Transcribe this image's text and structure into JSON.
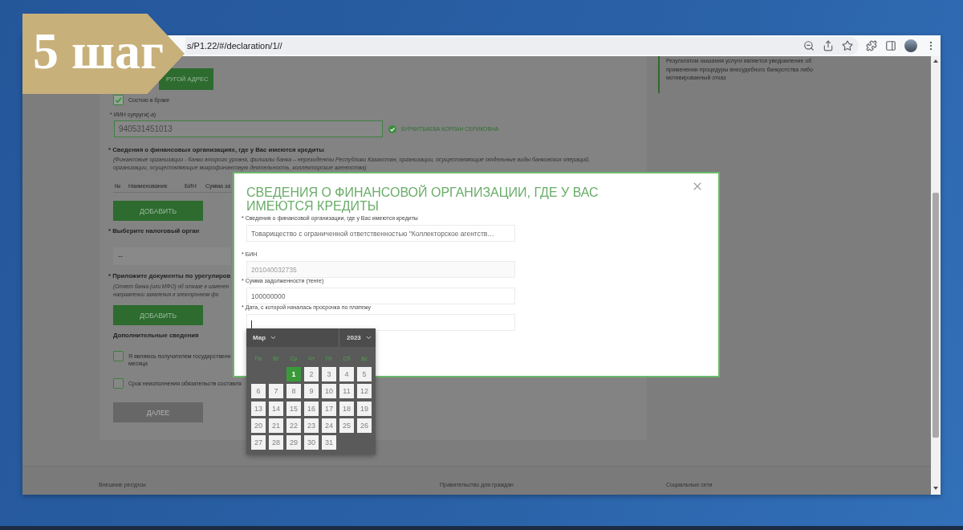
{
  "badge": {
    "text": "5 шаг"
  },
  "browser": {
    "url": "s/P1.22/#/declaration/1//"
  },
  "form": {
    "other_address_button": {
      "label": "РУГОЙ АДРЕС"
    },
    "married": {
      "label": "Состою в браке",
      "checked": true
    },
    "spouse_iin": {
      "label": "* ИИН супруги(-а)",
      "value": "940531451013",
      "verified": true,
      "verified_name": "БУРКИТБАЕВА КОРЛАН СЕРИКОВНА"
    },
    "credits": {
      "title": "* Сведения о финансовых организациях, где у Вас имеются кредиты",
      "note_lines": [
        "(Финансовые организации - банки второго уровня, филиалы банка – нерезиденты Республики Казахстан, организации, осуществляющие отдельные виды банковских операций,",
        "организации, осуществляющие микрофинансовую деятельность, коллекторские агентства)"
      ],
      "columns": [
        "№",
        "Наименование",
        "БИН",
        "Сумма за"
      ],
      "add_button": "ДОБАВИТЬ"
    },
    "tax_office": {
      "title": "* Выберите налоговый орган",
      "value": "--"
    },
    "documents": {
      "title": "* Приложите документы по урегулиров",
      "note_lines": [
        "(Ответ банка (или МФО) об отказе в изменен",
        "направлении заявления в электронном фо"
      ],
      "add_button": "ДОБАВИТЬ"
    },
    "additional": {
      "title": "Дополнительные сведения",
      "options": [
        {
          "lines": [
            "Я являюсь получателем государственн",
            "месяца"
          ],
          "checked": false
        },
        {
          "lines": [
            "Срок неисполнения обязательств составля"
          ],
          "checked": false
        }
      ]
    },
    "next_button": {
      "label": "ДАЛЕЕ",
      "disabled": true
    }
  },
  "info_note": "Результатом оказания услуги является уведомление об применении процедуры внесудебного банкротства либо мотивированный отказ",
  "footer": [
    "Внешние ресурсы",
    "Правительство для граждан",
    "Социальные сети"
  ],
  "modal": {
    "title": "СВЕДЕНИЯ О ФИНАНСОВОЙ ОРГАНИЗАЦИИ, ГДЕ У ВАС ИМЕЮТСЯ КРЕДИТЫ",
    "fields": [
      {
        "label": "* Сведения о финансовой организации, где у Вас имеются кредиты",
        "value": "Товарищество с ограниченной ответственностью \"Коллекторское агентств…",
        "disabled": false,
        "focused": false
      },
      {
        "label": "* БИН",
        "value": "201040032735",
        "disabled": true,
        "focused": false
      },
      {
        "label": "* Сумма задолженности (тенге)",
        "value": "100000000",
        "disabled": false,
        "focused": false
      },
      {
        "label": "* Дата, с которой началась просрочка по платежу",
        "disabled": false,
        "focused": true
      }
    ]
  },
  "datepicker": {
    "month": "Мар",
    "year": "2023",
    "weekdays": [
      "Пн",
      "Вт",
      "Ср",
      "Чт",
      "Пт",
      "Сб",
      "Вс"
    ],
    "weeks": [
      {
        "days": [
          {
            "label": "1",
            "selected": true
          },
          {
            "label": "2",
            "selected": false
          },
          {
            "label": "3",
            "selected": false
          },
          {
            "label": "4",
            "selected": false
          },
          {
            "label": "5",
            "selected": false
          }
        ]
      },
      {
        "days": [
          {
            "label": "6",
            "selected": false
          },
          {
            "label": "7",
            "selected": false
          },
          {
            "label": "8",
            "selected": false
          },
          {
            "label": "9",
            "selected": false
          },
          {
            "label": "10",
            "selected": false
          },
          {
            "label": "11",
            "selected": false
          },
          {
            "label": "12",
            "selected": false
          }
        ]
      },
      {
        "days": [
          {
            "label": "13",
            "selected": false
          },
          {
            "label": "14",
            "selected": false
          },
          {
            "label": "15",
            "selected": false
          },
          {
            "label": "16",
            "selected": false
          },
          {
            "label": "17",
            "selected": false
          },
          {
            "label": "18",
            "selected": false
          },
          {
            "label": "19",
            "selected": false
          }
        ]
      },
      {
        "days": [
          {
            "label": "20",
            "selected": false
          },
          {
            "label": "21",
            "selected": false
          },
          {
            "label": "22",
            "selected": false
          },
          {
            "label": "23",
            "selected": false
          },
          {
            "label": "24",
            "selected": false
          },
          {
            "label": "25",
            "selected": false
          },
          {
            "label": "26",
            "selected": false
          }
        ]
      },
      {
        "days": [
          {
            "label": "27",
            "selected": false
          },
          {
            "label": "28",
            "selected": false
          },
          {
            "label": "29",
            "selected": false
          },
          {
            "label": "30",
            "selected": false
          },
          {
            "label": "31",
            "selected": false
          }
        ]
      }
    ]
  }
}
